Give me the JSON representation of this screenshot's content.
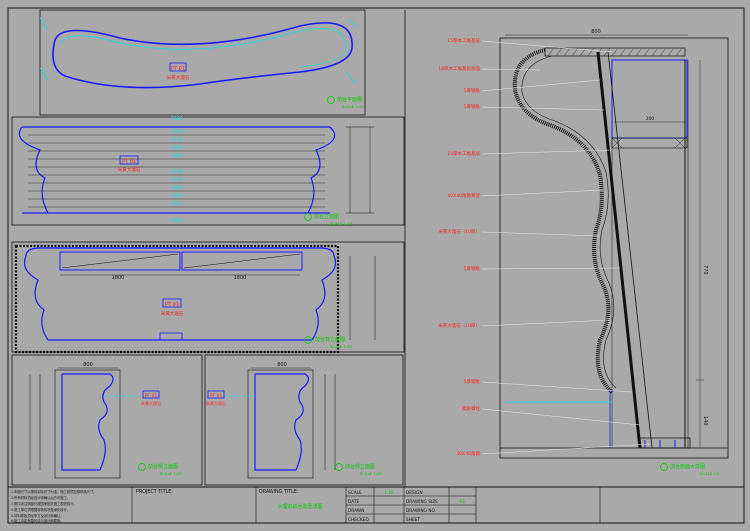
{
  "title_block": {
    "project_title_label": "PROJECT TITLE:",
    "drawing_title_label": "DRAWING TITLE:",
    "drawing_title_value": "大理石前台造型详图",
    "scale_label": "SCALE",
    "date_label": "DATE",
    "drawn_label": "DRAWN",
    "checked_label": "CHECKED",
    "design_label": "DESIGN",
    "drawing_size_label": "DRAWING SIZE",
    "drawing_no_label": "DRAWING NO.",
    "sheet_label": "SHEET",
    "scale_value": "1:20",
    "date_value": "",
    "drawn_value": "",
    "checked_value": "",
    "design_value": "",
    "drawing_size_value": "A3",
    "drawing_no_value": "",
    "sheet_value": ""
  },
  "notes": [
    "1.本图尺寸以现场实际尺寸为准，施工前须复核现场尺寸。",
    "2.所有材料须经设计师确认后方可施工。",
    "3.图中未注明部分按国家相关施工规范执行。",
    "4.施工单位须根据现场情况做深化设计。",
    "5.材料样板须经甲方及设计师确认。",
    "6.施工中如有疑问请与设计师联系。"
  ],
  "views": {
    "top_plan": {
      "title": "前台平面图",
      "scale": "SCALE 1:20",
      "material_tag": "PT 01",
      "material_name": "米黄大理石"
    },
    "front_elev": {
      "title": "前台立面图",
      "scale": "SCALE 1:20",
      "material_tag": "PT 01",
      "material_name": "米黄大理石"
    },
    "back_elev": {
      "title": "前台背立面图",
      "scale": "SCALE 1:20",
      "material_tag": "PT 01",
      "material_name": "米黄大理石",
      "dim_left": "1800",
      "dim_right": "1800"
    },
    "side_left": {
      "title": "前台侧立面图",
      "scale": "SCALE 1:20",
      "material_tag": "PT 01",
      "material_name": "米黄大理石",
      "dim_top": "800"
    },
    "side_right": {
      "title": "前台侧立面图",
      "scale": "SCALE 1:20",
      "material_tag": "PT 01",
      "material_name": "米黄大理石",
      "dim_top": "800"
    },
    "section": {
      "title": "前台剖面大样图",
      "scale": "SCALE 1:5",
      "dim_top": "800",
      "dim_inner": "200",
      "dim_right_upper": "770",
      "dim_right_lower": "140"
    }
  },
  "section_labels": [
    "15厚木工板基层",
    "18厚木工板基层加强",
    "5厚钢板",
    "5厚钢板",
    "15厚木工板基层",
    "40X40角钢骨架",
    "米黄大理石（10厚）",
    "5厚钢板",
    "米黄大理石（10厚）",
    "5厚钢板",
    "膨胀螺栓",
    "40X40角钢"
  ],
  "front_dims": [
    "2600",
    "2550",
    "2134",
    "2000",
    "1800",
    "2648",
    "2230",
    "1800",
    "2000",
    "2643",
    "5000"
  ],
  "colors": {
    "bg": "#a9a9a9",
    "blue": "#1a1aff",
    "cyan": "#00e6e6",
    "red": "#ff2020",
    "line": "#101010",
    "green": "#00cc00"
  }
}
